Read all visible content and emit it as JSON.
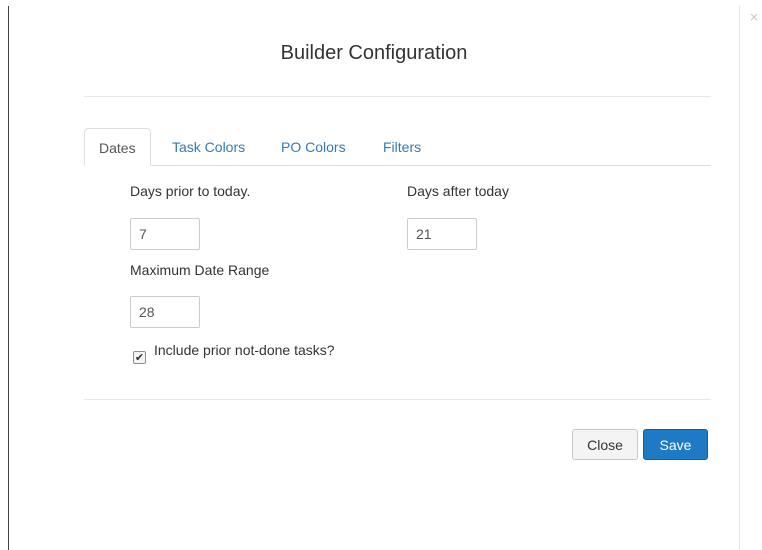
{
  "dialog": {
    "title": "Builder Configuration",
    "corner_close_symbol": "×"
  },
  "tabs": [
    {
      "label": "Dates",
      "active": true
    },
    {
      "label": "Task Colors",
      "active": false
    },
    {
      "label": "PO Colors",
      "active": false
    },
    {
      "label": "Filters",
      "active": false
    }
  ],
  "dates": {
    "days_prior": {
      "label": "Days prior to today.",
      "value": "7"
    },
    "days_after": {
      "label": "Days after today",
      "value": "21"
    },
    "max_range": {
      "label": "Maximum Date Range",
      "value": "28"
    },
    "include_prior": {
      "label": "Include prior not-done tasks?",
      "checked": true,
      "check_glyph": "✔"
    }
  },
  "footer": {
    "close_label": "Close",
    "save_label": "Save"
  },
  "colors": {
    "link": "#337ab7",
    "primary_button": "#1f7ac6"
  },
  "icons": {
    "corner_close": "close-icon",
    "checkbox": "checkmark-icon"
  }
}
